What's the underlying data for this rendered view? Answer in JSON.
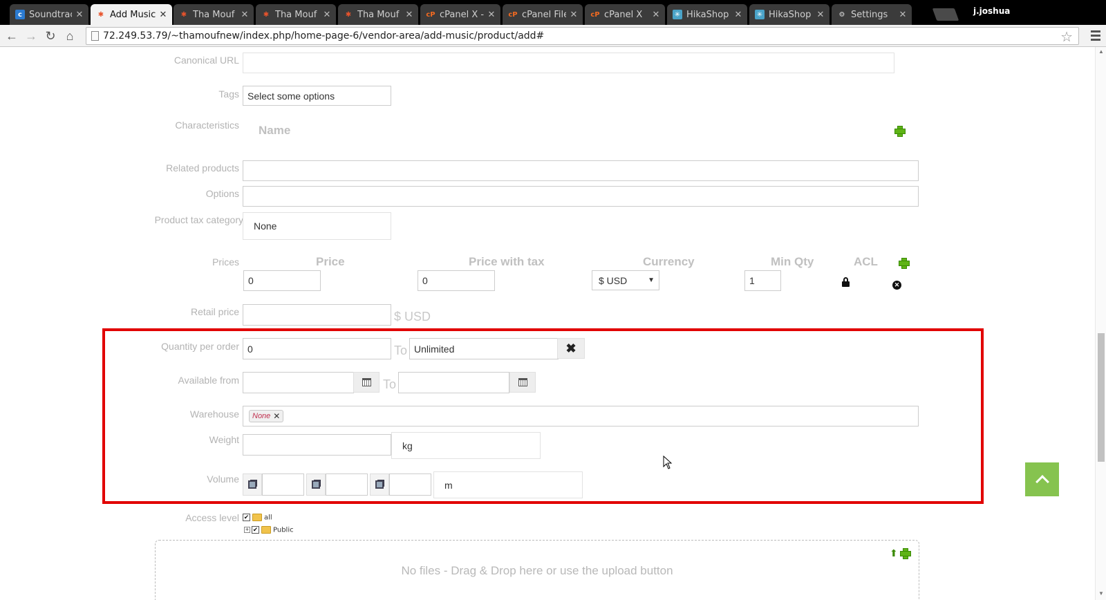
{
  "browser": {
    "tabs": [
      {
        "title": "Soundtracks",
        "active": false
      },
      {
        "title": "Add Music",
        "active": true
      },
      {
        "title": "Tha Mouf - /",
        "active": false
      },
      {
        "title": "Tha Mouf - /",
        "active": false
      },
      {
        "title": "Tha Mouf - /",
        "active": false
      },
      {
        "title": "cPanel X - M",
        "active": false
      },
      {
        "title": "cPanel File M",
        "active": false
      },
      {
        "title": "cPanel X",
        "active": false
      },
      {
        "title": "HikaShop - I",
        "active": false
      },
      {
        "title": "HikaShop - I",
        "active": false
      },
      {
        "title": "Settings",
        "active": false
      }
    ],
    "user": "j.joshua",
    "url": "72.249.53.79/~thamoufnew/index.php/home-page-6/vendor-area/add-music/product/add#"
  },
  "form": {
    "canonical_url": {
      "label": "Canonical URL",
      "value": ""
    },
    "tags": {
      "label": "Tags",
      "placeholder": "Select some options"
    },
    "characteristics": {
      "label": "Characteristics",
      "column": "Name"
    },
    "related_products": {
      "label": "Related products",
      "value": ""
    },
    "options": {
      "label": "Options",
      "value": ""
    },
    "tax_category": {
      "label": "Product tax category",
      "value": "None"
    },
    "prices": {
      "label": "Prices",
      "columns": [
        "Price",
        "Price with tax",
        "Currency",
        "Min Qty",
        "ACL"
      ],
      "row": {
        "price": "0",
        "price_with_tax": "0",
        "currency": "$ USD",
        "min_qty": "1"
      }
    },
    "retail_price": {
      "label": "Retail price",
      "value": "",
      "suffix": "$ USD"
    },
    "quantity_per_order": {
      "label": "Quantity per order",
      "min": "0",
      "to": "To",
      "max": "Unlimited"
    },
    "available_from": {
      "label": "Available from",
      "from": "",
      "to_label": "To",
      "to": ""
    },
    "warehouse": {
      "label": "Warehouse",
      "chip": "None"
    },
    "weight": {
      "label": "Weight",
      "value": "",
      "unit": "kg"
    },
    "volume": {
      "label": "Volume",
      "unit": "m"
    },
    "access_level": {
      "label": "Access level",
      "items": [
        "all",
        "Public"
      ]
    },
    "dropzone": {
      "message": "No files - Drag & Drop here or use the upload button"
    }
  },
  "colors": {
    "highlight": "#e10000",
    "accent_green": "#86c34f"
  }
}
